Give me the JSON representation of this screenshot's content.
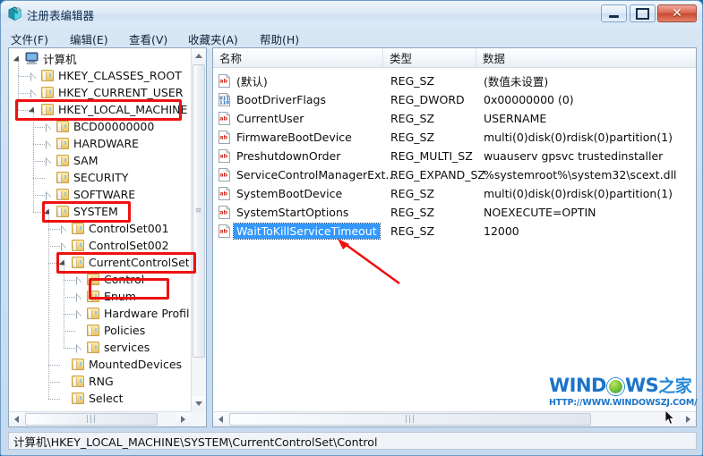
{
  "window": {
    "title": "注册表编辑器",
    "icon": "registry-editor-icon",
    "buttons": {
      "minimize": "最小化",
      "maximize": "最大化",
      "close": "关闭"
    }
  },
  "menu": [
    {
      "label": "文件(F)"
    },
    {
      "label": "编辑(E)"
    },
    {
      "label": "查看(V)"
    },
    {
      "label": "收藏夹(A)"
    },
    {
      "label": "帮助(H)"
    }
  ],
  "tree": [
    {
      "label": "计算机",
      "depth": 0,
      "state": "expanded",
      "icon": "computer-icon"
    },
    {
      "label": "HKEY_CLASSES_ROOT",
      "depth": 1,
      "state": "collapsed",
      "icon": "folder-icon"
    },
    {
      "label": "HKEY_CURRENT_USER",
      "depth": 1,
      "state": "collapsed",
      "icon": "folder-icon"
    },
    {
      "label": "HKEY_LOCAL_MACHINE",
      "depth": 1,
      "state": "expanded",
      "icon": "folder-icon"
    },
    {
      "label": "BCD00000000",
      "depth": 2,
      "state": "collapsed",
      "icon": "folder-icon"
    },
    {
      "label": "HARDWARE",
      "depth": 2,
      "state": "collapsed",
      "icon": "folder-icon"
    },
    {
      "label": "SAM",
      "depth": 2,
      "state": "collapsed",
      "icon": "folder-icon"
    },
    {
      "label": "SECURITY",
      "depth": 2,
      "state": "leaf",
      "icon": "folder-icon"
    },
    {
      "label": "SOFTWARE",
      "depth": 2,
      "state": "collapsed",
      "icon": "folder-icon"
    },
    {
      "label": "SYSTEM",
      "depth": 2,
      "state": "expanded",
      "icon": "folder-icon"
    },
    {
      "label": "ControlSet001",
      "depth": 3,
      "state": "collapsed",
      "icon": "folder-icon"
    },
    {
      "label": "ControlSet002",
      "depth": 3,
      "state": "collapsed",
      "icon": "folder-icon"
    },
    {
      "label": "CurrentControlSet",
      "depth": 3,
      "state": "expanded",
      "icon": "folder-icon"
    },
    {
      "label": "Control",
      "depth": 4,
      "state": "collapsed",
      "icon": "folder-icon"
    },
    {
      "label": "Enum",
      "depth": 4,
      "state": "collapsed",
      "icon": "folder-icon"
    },
    {
      "label": "Hardware Profiles",
      "depth": 4,
      "state": "collapsed",
      "icon": "folder-icon"
    },
    {
      "label": "Policies",
      "depth": 4,
      "state": "leaf",
      "icon": "folder-icon"
    },
    {
      "label": "services",
      "depth": 4,
      "state": "collapsed",
      "icon": "folder-icon"
    },
    {
      "label": "MountedDevices",
      "depth": 3,
      "state": "leaf",
      "icon": "folder-icon"
    },
    {
      "label": "RNG",
      "depth": 3,
      "state": "leaf",
      "icon": "folder-icon"
    },
    {
      "label": "Select",
      "depth": 3,
      "state": "leaf",
      "icon": "folder-icon"
    }
  ],
  "list": {
    "columns": [
      {
        "label": "名称"
      },
      {
        "label": "类型"
      },
      {
        "label": "数据"
      }
    ],
    "rows": [
      {
        "name": "(默认)",
        "type": "REG_SZ",
        "data": "(数值未设置)",
        "icon": "string-value-icon",
        "selected": false
      },
      {
        "name": "BootDriverFlags",
        "type": "REG_DWORD",
        "data": "0x00000000 (0)",
        "icon": "dword-value-icon",
        "selected": false
      },
      {
        "name": "CurrentUser",
        "type": "REG_SZ",
        "data": "USERNAME",
        "icon": "string-value-icon",
        "selected": false
      },
      {
        "name": "FirmwareBootDevice",
        "type": "REG_SZ",
        "data": "multi(0)disk(0)rdisk(0)partition(1)",
        "icon": "string-value-icon",
        "selected": false
      },
      {
        "name": "PreshutdownOrder",
        "type": "REG_MULTI_SZ",
        "data": "wuauserv gpsvc trustedinstaller",
        "icon": "string-value-icon",
        "selected": false
      },
      {
        "name": "ServiceControlManagerExt...",
        "type": "REG_EXPAND_SZ",
        "data": "%systemroot%\\system32\\scext.dll",
        "icon": "string-value-icon",
        "selected": false
      },
      {
        "name": "SystemBootDevice",
        "type": "REG_SZ",
        "data": "multi(0)disk(0)rdisk(0)partition(1)",
        "icon": "string-value-icon",
        "selected": false
      },
      {
        "name": "SystemStartOptions",
        "type": "REG_SZ",
        "data": " NOEXECUTE=OPTIN",
        "icon": "string-value-icon",
        "selected": false
      },
      {
        "name": "WaitToKillServiceTimeout",
        "type": "REG_SZ",
        "data": "12000",
        "icon": "string-value-icon",
        "selected": true
      }
    ]
  },
  "annotations": {
    "highlight_color": "#ee1111",
    "boxes": [
      {
        "target": "HKEY_LOCAL_MACHINE"
      },
      {
        "target": "SYSTEM"
      },
      {
        "target": "CurrentControlSet"
      },
      {
        "target": "Control"
      }
    ],
    "arrow": {
      "points_to": "WaitToKillServiceTimeout"
    }
  },
  "watermark": {
    "brand_prefix": "WIND",
    "brand_suffix": "WS",
    "brand_cn": "之家",
    "url": "HTTP://WWW.WINDOWSZJ.COM/"
  },
  "statusbar": {
    "path": "计算机\\HKEY_LOCAL_MACHINE\\SYSTEM\\CurrentControlSet\\Control"
  }
}
